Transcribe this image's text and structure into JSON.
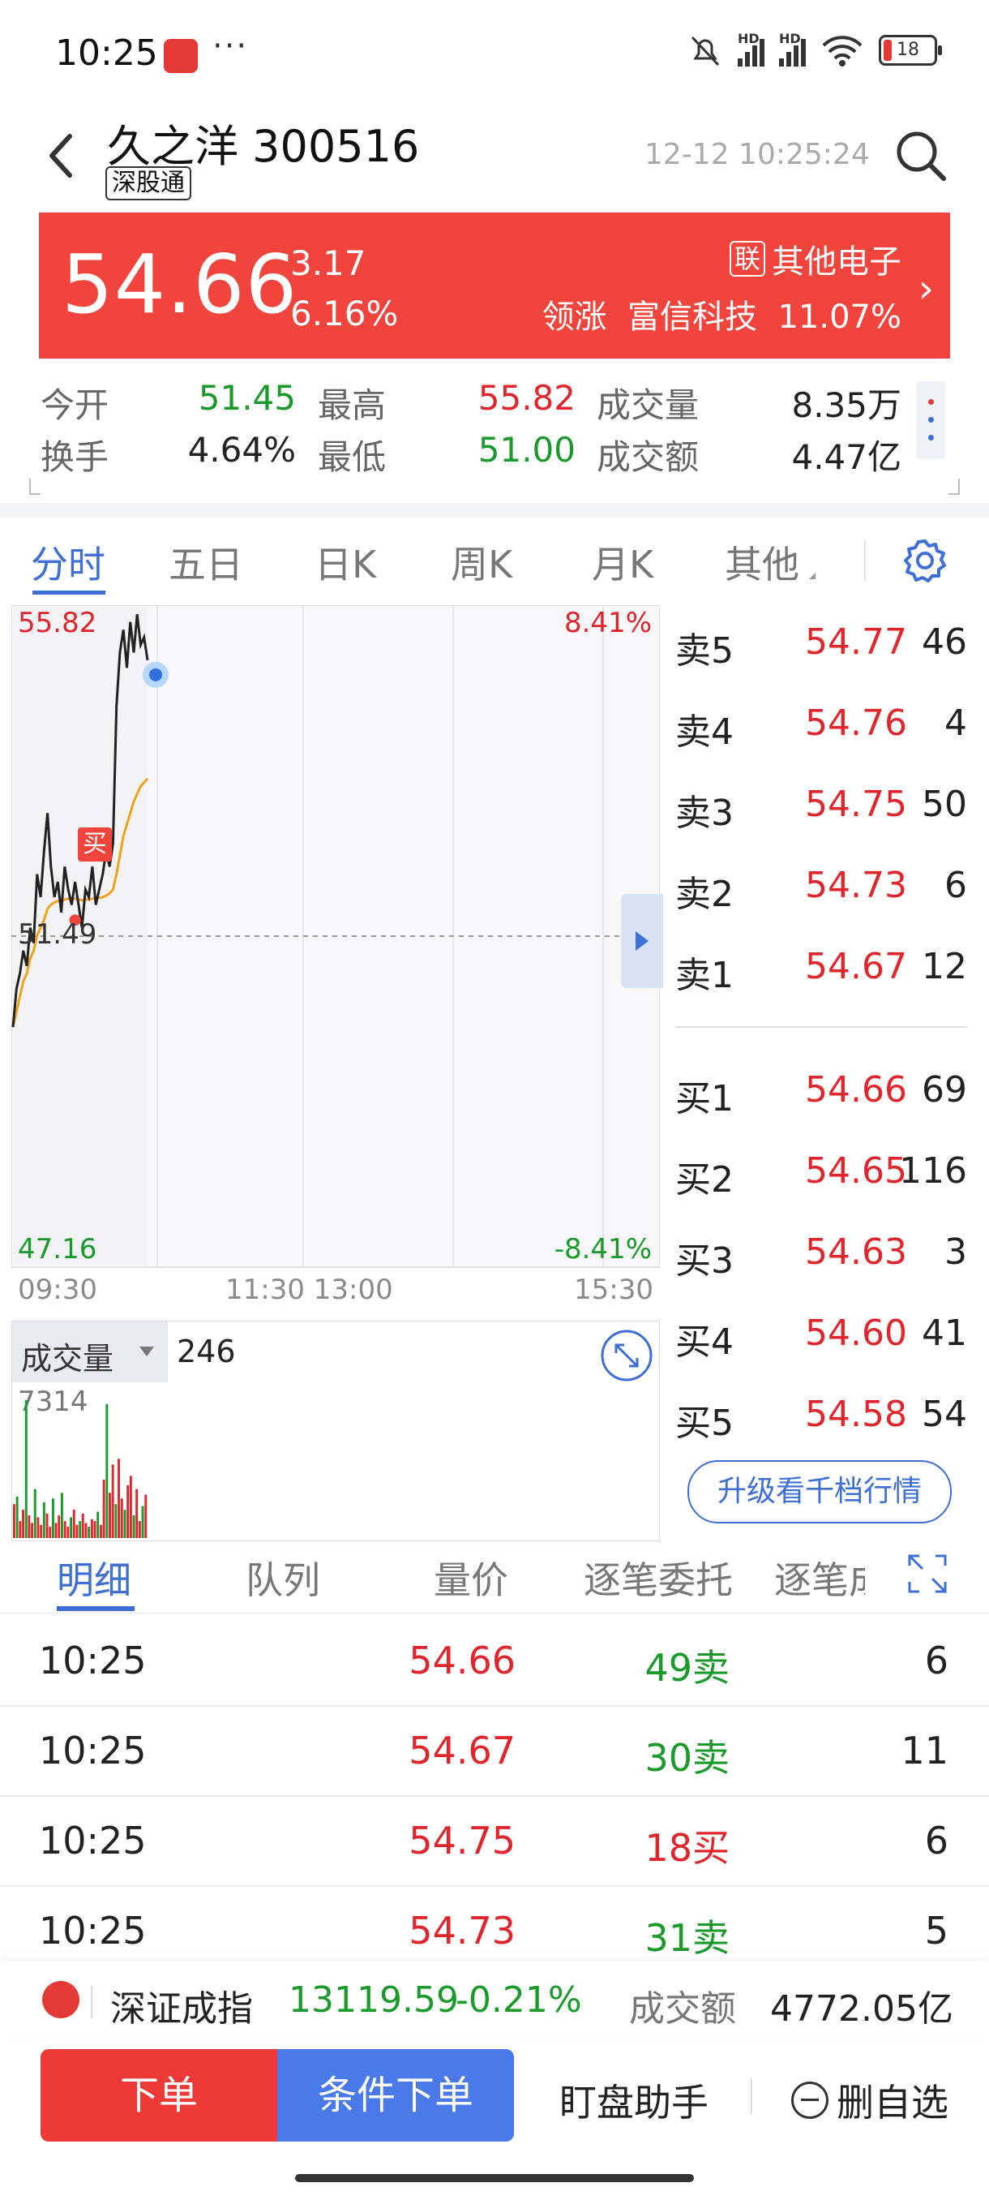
{
  "status_bar": {
    "time": "10:25",
    "battery": "18",
    "dots": "···",
    "hd": "HD"
  },
  "header": {
    "name": "久之洋",
    "code": "300516",
    "tag": "深股通",
    "timestamp": "12-12 10:25:24"
  },
  "banner": {
    "price": "54.66",
    "change": "3.17",
    "change_pct": "6.16%",
    "sector_badge": "联",
    "sector": "其他电子",
    "lead_label": "领涨",
    "lead_stock": "富信科技",
    "lead_pct": "11.07%"
  },
  "stats": {
    "open_label": "今开",
    "open": "51.45",
    "high_label": "最高",
    "high": "55.82",
    "volume_label": "成交量",
    "volume": "8.35万",
    "turnover_label": "换手",
    "turnover": "4.64%",
    "low_label": "最低",
    "low": "51.00",
    "amount_label": "成交额",
    "amount": "4.47亿"
  },
  "chart_tabs": [
    "分时",
    "五日",
    "日K",
    "周K",
    "月K",
    "其他"
  ],
  "chart_data": {
    "type": "line",
    "y_top": "55.82",
    "y_mid": "51.49",
    "y_bottom": "47.16",
    "pct_top": "8.41%",
    "pct_bottom": "-8.41%",
    "x_labels": [
      "09:30",
      "11:30 13:00",
      "15:30"
    ],
    "ylim": [
      47.16,
      55.82
    ],
    "price_series": [
      50.3,
      50.8,
      51.0,
      51.3,
      51.1,
      51.6,
      51.4,
      52.3,
      52.0,
      52.6,
      53.1,
      52.4,
      52.0,
      52.2,
      51.8,
      52.4,
      52.1,
      51.9,
      52.2,
      51.9,
      51.6,
      52.1,
      52.0,
      52.4,
      51.9,
      52.1,
      52.3,
      52.6,
      52.4,
      52.7,
      54.5,
      55.2,
      55.5,
      55.0,
      55.6,
      55.2,
      55.7,
      55.3,
      55.4,
      55.1
    ],
    "avg_series": [
      50.3,
      50.5,
      50.7,
      50.9,
      51.0,
      51.2,
      51.3,
      51.5,
      51.6,
      51.7,
      51.85,
      51.9,
      51.93,
      51.95,
      51.95,
      51.97,
      51.98,
      51.97,
      51.98,
      51.97,
      51.96,
      51.97,
      51.97,
      51.98,
      51.98,
      51.99,
      52.0,
      52.02,
      52.05,
      52.1,
      52.3,
      52.55,
      52.8,
      52.95,
      53.1,
      53.25,
      53.35,
      53.45,
      53.5,
      53.55
    ],
    "buy_marker": "买",
    "volume_label": "成交量",
    "volume_value": "246",
    "volume_max": "7314",
    "volume_bars": [
      1800,
      2200,
      900,
      1500,
      7314,
      1200,
      800,
      2600,
      1100,
      700,
      1900,
      1300,
      600,
      2100,
      800,
      1200,
      2400,
      900,
      600,
      1100,
      1500,
      700,
      900,
      1300,
      800,
      600,
      1000,
      900,
      1400,
      700,
      3100,
      7100,
      2400,
      3900,
      1800,
      4200,
      2100,
      1500,
      2800,
      3300,
      1200,
      2600,
      900,
      1700,
      2300
    ]
  },
  "order_book": {
    "asks": [
      {
        "label": "卖5",
        "price": "54.77",
        "vol": "46"
      },
      {
        "label": "卖4",
        "price": "54.76",
        "vol": "4"
      },
      {
        "label": "卖3",
        "price": "54.75",
        "vol": "50"
      },
      {
        "label": "卖2",
        "price": "54.73",
        "vol": "6"
      },
      {
        "label": "卖1",
        "price": "54.67",
        "vol": "12"
      }
    ],
    "bids": [
      {
        "label": "买1",
        "price": "54.66",
        "vol": "69"
      },
      {
        "label": "买2",
        "price": "54.65",
        "vol": "116"
      },
      {
        "label": "买3",
        "price": "54.63",
        "vol": "3"
      },
      {
        "label": "买4",
        "price": "54.60",
        "vol": "41"
      },
      {
        "label": "买5",
        "price": "54.58",
        "vol": "54"
      }
    ],
    "upgrade": "升级看千档行情"
  },
  "detail_tabs": [
    "明细",
    "队列",
    "量价",
    "逐笔委托",
    "逐笔成"
  ],
  "trades": [
    {
      "time": "10:25",
      "price": "54.66",
      "vol": "49卖",
      "dir": "sell",
      "count": "6"
    },
    {
      "time": "10:25",
      "price": "54.67",
      "vol": "30卖",
      "dir": "sell",
      "count": "11"
    },
    {
      "time": "10:25",
      "price": "54.75",
      "vol": "18买",
      "dir": "buy",
      "count": "6"
    },
    {
      "time": "10:25",
      "price": "54.73",
      "vol": "31卖",
      "dir": "sell",
      "count": "5"
    }
  ],
  "index_bar": {
    "name": "深证成指",
    "value": "13119.59",
    "change": "-0.21%",
    "amount_label": "成交额",
    "amount": "4772.05亿"
  },
  "actions": {
    "order": "下单",
    "conditional": "条件下单",
    "watch": "盯盘助手",
    "remove": "删自选"
  },
  "colors": {
    "red": "#e0252c",
    "green": "#1a9a2a",
    "blue": "#3d6fd6",
    "banner": "#f0443d"
  }
}
